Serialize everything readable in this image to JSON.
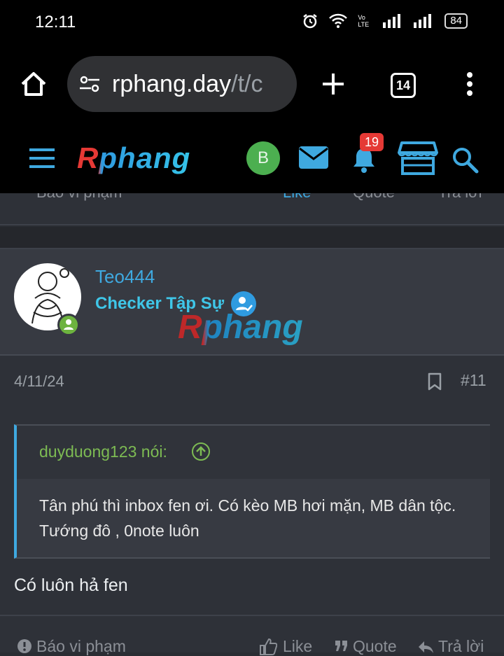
{
  "status_bar": {
    "time": "12:11",
    "battery": "84",
    "network_label": "Vo LTE"
  },
  "browser": {
    "url_domain": "rphang.day",
    "url_path": "/t/c",
    "tab_count": "14"
  },
  "site_header": {
    "logo": "Rphang",
    "avatar_letter": "B",
    "notification_count": "19"
  },
  "prev_post_actions": {
    "report": "Báo vi phạm",
    "like": "Like",
    "quote": "Quote",
    "reply": "Trả lời"
  },
  "post": {
    "username": "Teo444",
    "user_title": "Checker Tập Sự",
    "watermark": "Rphang",
    "date": "4/11/24",
    "post_number": "#11",
    "quote_author": "duyduong123 nói:",
    "quote_text": "Tân phú thì inbox fen ơi. Có kèo MB hơi mặn, MB dân tộc. Tướng đô , 0note luôn",
    "content": "Có luôn hả fen"
  },
  "post_actions": {
    "report": "Báo vi phạm",
    "like": "Like",
    "quote": "Quote",
    "reply": "Trả lời"
  },
  "colors": {
    "accent": "#3fa9e0",
    "quote_author": "#7dbb53",
    "badge": "#e53935",
    "online": "#6db33f"
  }
}
